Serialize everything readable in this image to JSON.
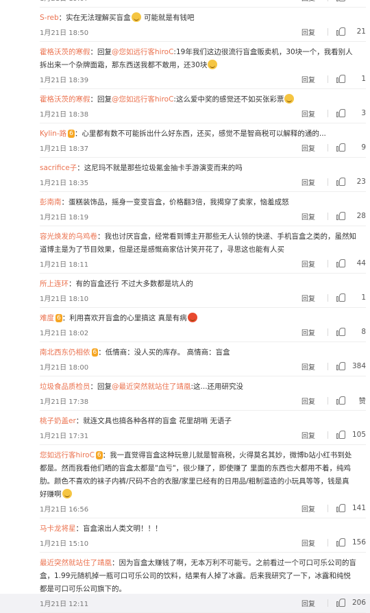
{
  "comments": [
    {
      "user": "",
      "text": "",
      "time": "1月21日 19:07",
      "reply": "回复",
      "likes": "25"
    },
    {
      "user": "S-reb",
      "text": "：实在无法理解买盲盒",
      "emoji_after": true,
      "text2": " 可能就是有钱吧",
      "time": "1月21日 18:50",
      "reply": "回复",
      "likes": "21"
    },
    {
      "user": "霍格沃茨的寒假",
      "text": "：回复",
      "mention": "@您如远行客hiroC",
      "text2": ":19年我们这边很流行盲盒贩卖机，30块一个，我看别人拆出来一个杂牌面霜，那东西送我都不敢用，还30块",
      "emoji_end": true,
      "time": "1月21日 18:39",
      "reply": "回复",
      "likes": "1"
    },
    {
      "user": "霍格沃茨的寒假",
      "text": "：回复",
      "mention": "@您如远行客hiroC",
      "text2": ":这么爱中奖的感觉还不如买张彩票",
      "emoji_end": true,
      "time": "1月21日 18:38",
      "reply": "回复",
      "likes": "3"
    },
    {
      "user": "Kylin-路",
      "vip": "6",
      "text": "：心里都有数不可能拆出什么好东西，还买，感觉不是智商税可以解释的通的...",
      "time": "1月21日 18:37",
      "reply": "回复",
      "likes": "9"
    },
    {
      "user": "sacrifice子",
      "text": "：这尼玛不就是那些垃圾氪金抽卡手游演变而来的吗",
      "time": "1月21日 18:35",
      "reply": "回复",
      "likes": "23"
    },
    {
      "user": "彭南南",
      "text": "：蛋糕装饰品，摇身一变变盲盒，价格翻3倍，我揭穿了卖家，恼羞成怒",
      "time": "1月21日 18:19",
      "reply": "回复",
      "likes": "28"
    },
    {
      "user": "容光焕发的乌鸡卷",
      "text": "：我也讨厌盲盒，经常看到博主开那些无人认领的快递、手机盲盒之类的，虽然知道博主是为了节目效果，但是还是感慨商家估计笑开花了，寻思这也能有人买",
      "time": "1月21日 18:11",
      "reply": "回复",
      "likes": "44"
    },
    {
      "user": "所上连环",
      "text": "：有的盲盒还行 不过大多数都是坑人的",
      "time": "1月21日 18:10",
      "reply": "回复",
      "likes": "1"
    },
    {
      "user": "难度",
      "vip": "6",
      "text": "：利用喜欢开盲盒的心里搞这 真是有病",
      "emoji_red": true,
      "time": "1月21日 18:02",
      "reply": "回复",
      "likes": "8"
    },
    {
      "user": "南北西东仍相依",
      "vip": "6",
      "text": "：低情商：没人买的库存。 高情商：盲盒",
      "time": "1月21日 18:00",
      "reply": "回复",
      "likes": "384"
    },
    {
      "user": "垃圾食品质检员",
      "text": "：回复",
      "mention": "@最近突然就站住了靖凰",
      "text2": ":这...还用研究没",
      "time": "1月21日 17:38",
      "reply": "回复",
      "likes": "赞"
    },
    {
      "user": "桃子奶盖er",
      "text": "：就连文具也搞各种各样的盲盒 花里胡哨 无语子",
      "time": "1月21日 17:31",
      "reply": "回复",
      "likes": "105"
    },
    {
      "user": "您如远行客hiroC",
      "vip": "6",
      "text": "：我一直觉得盲盒这种玩意儿就是智商税，火得莫名其妙，微博b站小红书到处都是。然而我看他们晒的盲盒太都是\"血亏\"，很少赚了，即使赚了 里面的东西也大都用不着，纯鸡肋。颜色不喜欢的袜子内裤/尺码不合的衣服/家里已经有的日用品/粗制滥造的小玩具等等，钱是真好赚啊",
      "emoji_end": true,
      "time": "1月21日 16:56",
      "reply": "回复",
      "likes": "141"
    },
    {
      "user": "马卡龙将星",
      "text": "：盲盒滚出人类文明！！！",
      "time": "1月21日 15:10",
      "reply": "回复",
      "likes": "156"
    },
    {
      "user": "最近突然就站住了靖凰",
      "text": "：因为盲盒太赚钱了啊，无本万利不可能亏。之前看过一个可口可乐公司的盲盒，1.99元随机掉一瓶可口可乐公司的饮料，结果有人掉了冰露。后来我研究了一下，冰露和纯悦都是可口可乐公司旗下的。",
      "time": "1月21日 12:11",
      "reply": "回复",
      "likes": "206"
    }
  ]
}
